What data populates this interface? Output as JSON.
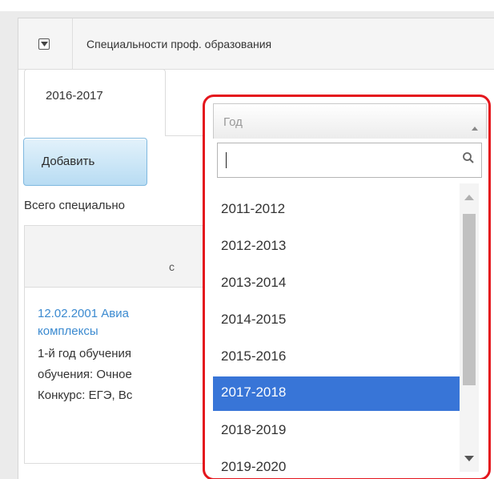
{
  "panel": {
    "title": "Специальности проф. образования",
    "collapse_icon": "collapse-toggle-icon"
  },
  "tabs": [
    {
      "label": "2016-2017",
      "active": true
    }
  ],
  "toolbar": {
    "add_label": "Добавить"
  },
  "summary": {
    "total_label": "Всего специально"
  },
  "table": {
    "header_fragment": "с"
  },
  "row": {
    "link_line1": "12.02.2001 Авиа",
    "link_line2": "комплексы",
    "text_line1": "1-й год обучения",
    "text_line2": "обучения: Очное",
    "text_line3": "Конкурс: ЕГЭ, Вс"
  },
  "year_select": {
    "placeholder": "Год",
    "search_value": "",
    "search_icon": "magnifier-icon",
    "options": [
      "2011-2012",
      "2012-2013",
      "2013-2014",
      "2014-2015",
      "2015-2016",
      "2017-2018",
      "2018-2019",
      "2019-2020"
    ],
    "selected": "2017-2018",
    "highlight_color": "#3875d7"
  },
  "colors": {
    "link": "#3b8ad0",
    "annotation_outline": "#e4161d"
  }
}
